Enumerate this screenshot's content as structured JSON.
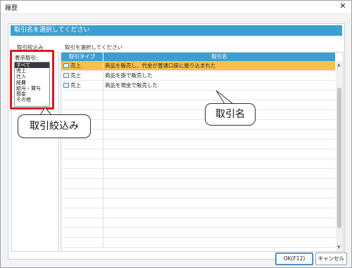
{
  "window": {
    "title": "履歴",
    "close_glyph": "✕"
  },
  "panel": {
    "header": "取引名を選択してください"
  },
  "left": {
    "section_label": "取引絞込み",
    "filter_label": "表示取引:",
    "filter_items": [
      "すべて",
      "売上",
      "仕入",
      "経費",
      "給与・賞与",
      "預金",
      "その他"
    ],
    "selected_index": 0
  },
  "grid": {
    "section_label": "取引を選択してください",
    "columns": [
      "取引タイプ",
      "取引名"
    ],
    "rows": [
      {
        "type": "売上",
        "name": "商品を販売し、代金が普通口座に振り込まれた",
        "selected": true
      },
      {
        "type": "売上",
        "name": "商品を掛で販売した",
        "selected": false
      },
      {
        "type": "売上",
        "name": "商品を現金で販売した",
        "selected": false
      }
    ]
  },
  "callouts": {
    "filter": "取引絞込み",
    "name": "取引名"
  },
  "buttons": {
    "ok": "OK(F12)",
    "cancel": "キャンセル"
  },
  "colors": {
    "accent": "#3d9fcf",
    "selection": "#f6c14a",
    "highlight_border": "#e2161c"
  }
}
